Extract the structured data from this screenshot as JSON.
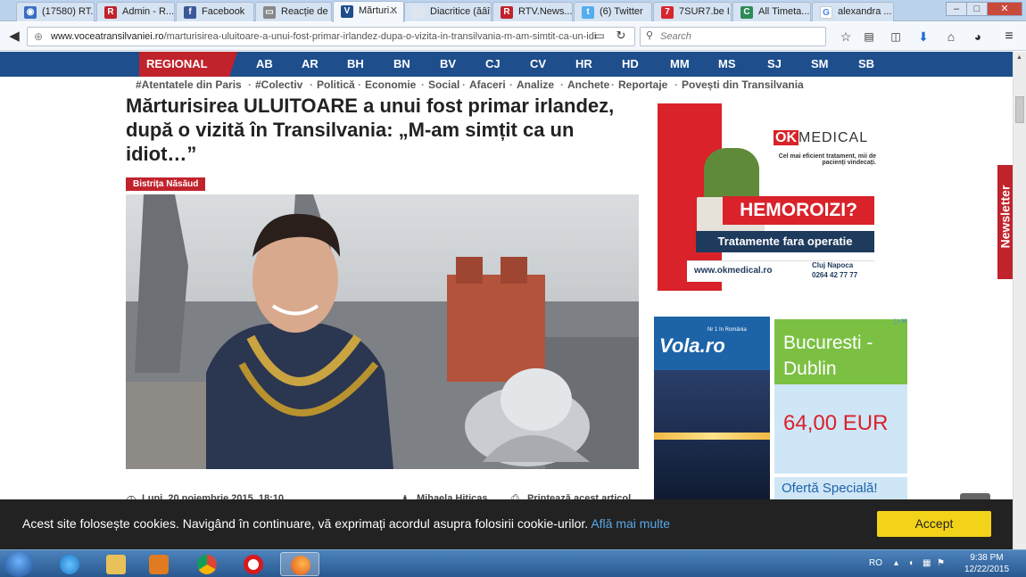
{
  "browser": {
    "tabs": [
      {
        "label": "(17580) RT...",
        "icon_color": "#3a6fc4",
        "icon_glyph": "◉",
        "active": false
      },
      {
        "label": "Admin - R...",
        "icon_color": "#c0232c",
        "icon_glyph": "R",
        "active": false
      },
      {
        "label": "Facebook",
        "icon_color": "#3b5998",
        "icon_glyph": "f",
        "active": false
      },
      {
        "label": "Reacție de ...",
        "icon_color": "#888888",
        "icon_glyph": "▭",
        "active": false
      },
      {
        "label": "Mărturi...",
        "icon_color": "#1e4e8c",
        "icon_glyph": "V",
        "active": true
      },
      {
        "label": "Diacritice (ăâîș...",
        "icon_color": "#dfe6ef",
        "icon_glyph": "",
        "active": false
      },
      {
        "label": "RTV.News...",
        "icon_color": "#c0232c",
        "icon_glyph": "R",
        "active": false
      },
      {
        "label": "(6) Twitter",
        "icon_color": "#55acee",
        "icon_glyph": "t",
        "active": false
      },
      {
        "label": "7SUR7.be I...",
        "icon_color": "#d8262f",
        "icon_glyph": "7",
        "active": false
      },
      {
        "label": "All Timeta...",
        "icon_color": "#2e8b57",
        "icon_glyph": "C",
        "active": false
      },
      {
        "label": "alexandra ...",
        "icon_color": "#ffffff",
        "icon_glyph": "G",
        "active": false
      }
    ],
    "url_domain": "www.voceatransilvaniei.ro",
    "url_path": "/marturisirea-uluitoare-a-unui-fost-primar-irlandez-dupa-o-vizita-in-transilvania-m-am-simtit-ca-un-idi",
    "search_placeholder": "Search"
  },
  "site": {
    "regional_label": "REGIONAL",
    "counties": [
      "AB",
      "AR",
      "BH",
      "BN",
      "BV",
      "CJ",
      "CV",
      "HR",
      "HD",
      "MM",
      "MS",
      "SJ",
      "SM",
      "SB"
    ],
    "topics": [
      "#Atentatele din Paris",
      "#Colectiv",
      "Politică",
      "Economie",
      "Social",
      "Afaceri",
      "Analize",
      "Anchete",
      "Reportaje",
      "Povești din Transilvania"
    ],
    "nav_color": "#1e4e8c",
    "accent_color": "#c0232c"
  },
  "article": {
    "title": "Mărturisirea ULUITOARE a unui fost primar irlandez, după o vizită în Transilvania: „M-am simțit ca un idiot…”",
    "category": "Bistrița Năsăud",
    "date": "Luni, 20 noiembrie 2015, 18:10",
    "author": "Mihaela Hiticaș",
    "print_label": "Printează acest articol"
  },
  "ads": {
    "okmedical": {
      "brand_ok": "OK",
      "brand_medical": "MEDICAL",
      "tagline": "Cel mai eficient tratament, mii de pacienți vindecați.",
      "headline": "HEMOROIZI?",
      "subhead": "Tratamente fara operatie",
      "url": "www.okmedical.ro",
      "city": "Cluj Napoca",
      "phone": "0264 42 77 77"
    },
    "vola": {
      "brand": "Vola.ro",
      "badge": "Nr 1 în România",
      "route": "Bucuresti - Dublin",
      "price": "64,00 EUR",
      "cta": "Ofertă Specială!"
    },
    "newsletter_label": "Newsletter"
  },
  "cookie": {
    "message": "Acest site folosește cookies. Navigând în continuare, vă exprimați acordul asupra folosirii cookie-urilor.",
    "more_link": "Află mai multe",
    "accept_label": "Accept"
  },
  "taskbar": {
    "language": "RO",
    "time": "9:38 PM",
    "date": "12/22/2015"
  }
}
